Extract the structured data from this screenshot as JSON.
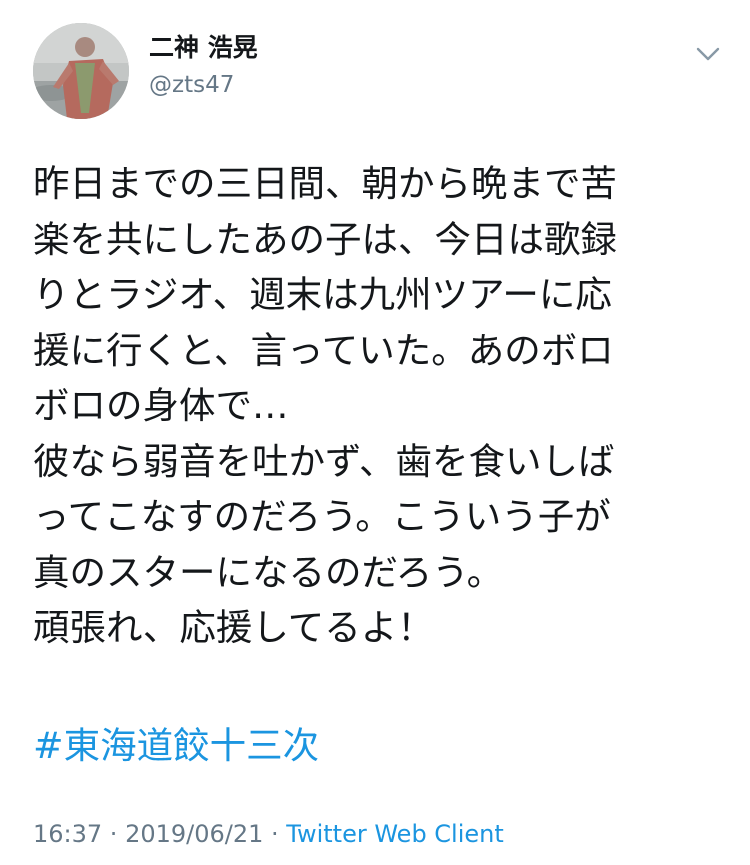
{
  "author": {
    "name": "二神 浩晃",
    "handle": "@zts47"
  },
  "tweet": {
    "lines": [
      "昨日までの三日間、朝から晩まで苦",
      "楽を共にしたあの子は、今日は歌録",
      "りとラジオ、週末は九州ツアーに応",
      "援に行くと、言っていた。あのボロ",
      "ボロの身体で…",
      "彼なら弱音を吐かず、歯を食いしば",
      "ってこなすのだろう。こういう子が",
      "真のスターになるのだろう。",
      "頑張れ、応援してるよ！"
    ],
    "hashtag": "#東海道餃十三次"
  },
  "meta": {
    "time": "16:37",
    "separator1": " · ",
    "date": "2019/06/21",
    "separator2": " · ",
    "client": "Twitter Web Client"
  },
  "icons": {
    "menu": "chevron-down-icon",
    "avatar": "avatar-photo"
  },
  "colors": {
    "text": "#14171a",
    "secondary": "#657786",
    "link": "#1b95e0",
    "background": "#ffffff"
  }
}
